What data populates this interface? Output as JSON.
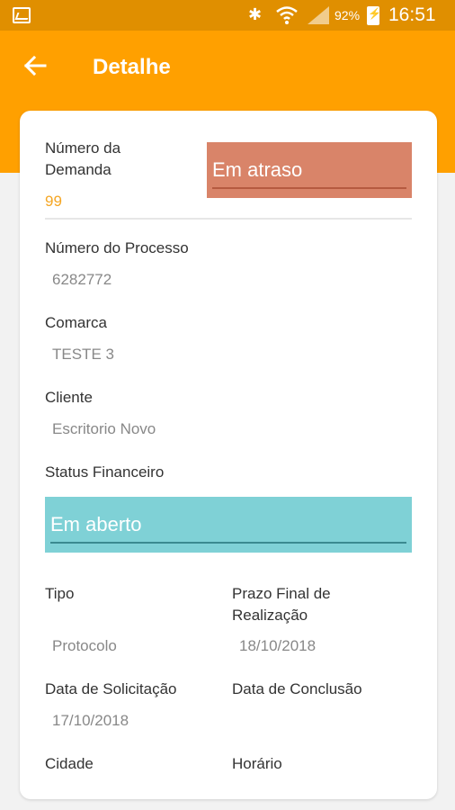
{
  "status_bar": {
    "battery": "92%",
    "time": "16:51"
  },
  "header": {
    "title": "Detalhe"
  },
  "detail": {
    "demand_number_label": "Número da\nDemanda",
    "demand_number_value": "99",
    "demand_status": "Em atraso",
    "process_number_label": "Número do Processo",
    "process_number_value": "6282772",
    "comarca_label": "Comarca",
    "comarca_value": "TESTE 3",
    "client_label": "Cliente",
    "client_value": "Escritorio Novo",
    "financial_status_label": "Status Financeiro",
    "financial_status_value": "Em aberto",
    "type_label": "Tipo",
    "type_value": "Protocolo",
    "deadline_label": "Prazo Final de\nRealização",
    "deadline_value": "18/10/2018",
    "request_date_label": "Data de Solicitação",
    "request_date_value": "17/10/2018",
    "completion_date_label": "Data de Conclusão",
    "city_label": "Cidade",
    "time_label": "Horário"
  },
  "colors": {
    "appbar": "#ffa000",
    "statusbar": "#e08f00",
    "late_status_bg": "#d98469",
    "late_status_line": "#b55a40",
    "open_status_bg": "#7fd1d6",
    "open_status_line": "#3b8a90"
  }
}
